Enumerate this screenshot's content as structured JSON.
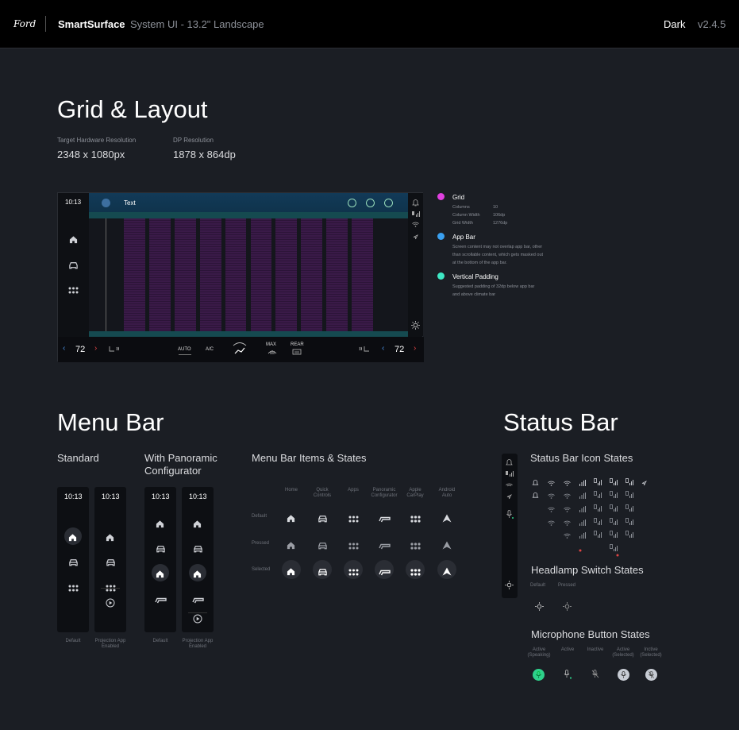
{
  "topbar": {
    "logo": "Ford",
    "brand": "SmartSurface",
    "subtitle": "System UI - 13.2\" Landscape",
    "theme": "Dark",
    "version": "v2.4.5"
  },
  "grid_section": {
    "title": "Grid & Layout",
    "target_label": "Target Hardware Resolution",
    "target_value": "2348 x 1080px",
    "dp_label": "DP Resolution",
    "dp_value": "1878 x 864dp"
  },
  "demo": {
    "time": "10:13",
    "app_text": "Text",
    "temp_left": "72",
    "temp_right": "72",
    "auto": "AUTO",
    "ac": "A/C",
    "max": "MAX",
    "rear": "REAR"
  },
  "legend": {
    "grid_title": "Grid",
    "columns_label": "Columns",
    "columns_value": "10",
    "colwidth_label": "Column Width",
    "colwidth_value": "106dp",
    "gridwidth_label": "Grid Width",
    "gridwidth_value": "1276dp",
    "appbar_title": "App Bar",
    "appbar_desc1": "Screen content may not overlap app bar, other",
    "appbar_desc2": "than scrollable content, which gets masked out",
    "appbar_desc3": "at the bottom of the app bar.",
    "vpad_title": "Vertical Padding",
    "vpad_desc1": "Suggested padding of 32dp below app bar",
    "vpad_desc2": "and above climate bar",
    "colors": {
      "grid": "#e040e0",
      "appbar": "#3aa0f0",
      "vpad": "#3ee8c4"
    }
  },
  "menubar": {
    "title": "Menu Bar",
    "standard": "Standard",
    "panoramic1": "With Panoramic",
    "panoramic2": "Configurator",
    "items_title": "Menu Bar Items & States",
    "time": "10:13",
    "cap_default": "Default",
    "cap_proj1": "Projection App",
    "cap_proj2": "Enabled",
    "col_home": "Home",
    "col_quick1": "Quick",
    "col_quick2": "Controls",
    "col_apps": "Apps",
    "col_pan1": "Panoramic",
    "col_pan2": "Configurator",
    "col_carplay1": "Apple",
    "col_carplay2": "CarPlay",
    "col_android1": "Android",
    "col_android2": "Auto",
    "row_default": "Default",
    "row_pressed": "Pressed",
    "row_selected": "Selected"
  },
  "statusbar": {
    "title": "Status Bar",
    "icon_states": "Status Bar Icon States",
    "headlamp_title": "Headlamp Switch States",
    "headlamp_default": "Default",
    "headlamp_pressed": "Pressed",
    "mic_title": "Microphone Button States",
    "mic_active_speaking1": "Active",
    "mic_active_speaking2": "(Speaking)",
    "mic_active": "Active",
    "mic_inactive": "Inactive",
    "mic_active_sel1": "Active",
    "mic_active_sel2": "(Selected)",
    "mic_inactive_sel1": "Inctive",
    "mic_inactive_sel2": "(Selected)",
    "accent_green": "#2ed18b"
  }
}
